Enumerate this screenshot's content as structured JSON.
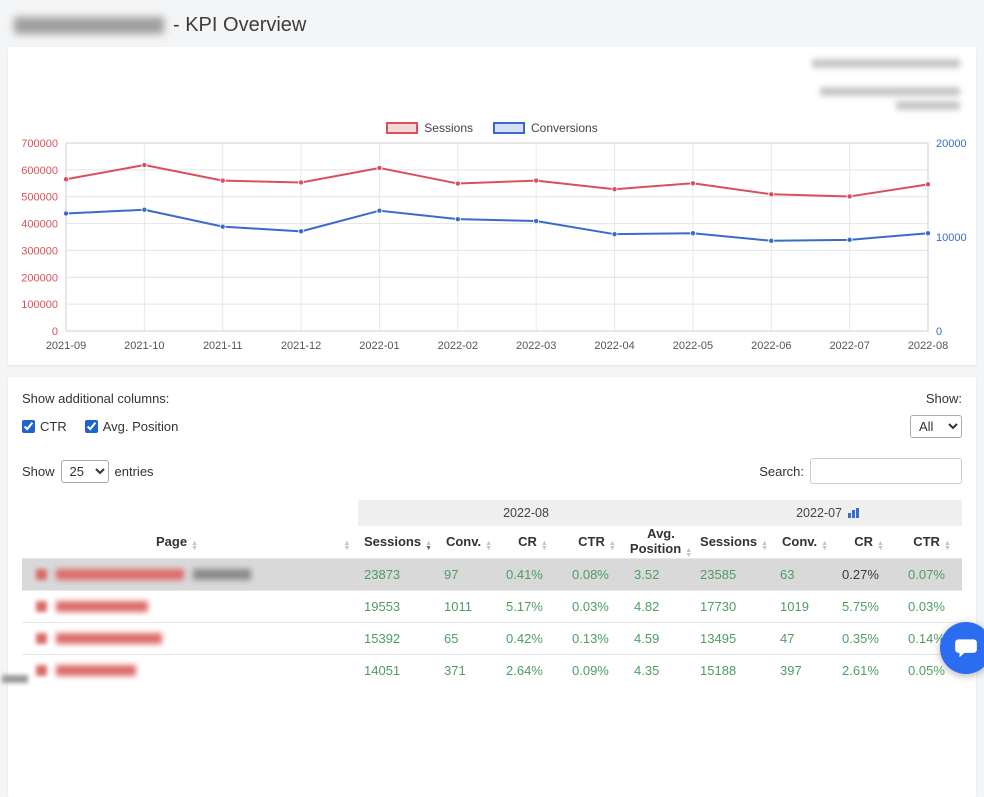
{
  "page": {
    "title_suffix": "- KPI Overview"
  },
  "chart_panel": {
    "info_lines_redacted": 3,
    "legend": [
      {
        "label": "Sessions",
        "color": "#d9505c",
        "fill": "#f3d8da"
      },
      {
        "label": "Conversions",
        "color": "#3a6bc9",
        "fill": "#d6e1f3"
      }
    ]
  },
  "chart_data": {
    "type": "line",
    "x": [
      "2021-09",
      "2021-10",
      "2021-11",
      "2021-12",
      "2022-01",
      "2022-02",
      "2022-03",
      "2022-04",
      "2022-05",
      "2022-06",
      "2022-07",
      "2022-08"
    ],
    "series": [
      {
        "name": "Sessions",
        "axis": "left",
        "color": "#d9505c",
        "values": [
          565000,
          618000,
          560000,
          553000,
          607000,
          549000,
          560000,
          528000,
          550000,
          509000,
          501000,
          546000
        ]
      },
      {
        "name": "Conversions",
        "axis": "right",
        "color": "#3a6bc9",
        "values": [
          12500,
          12900,
          11100,
          10600,
          12800,
          11900,
          11700,
          10300,
          10400,
          9600,
          9700,
          10400
        ]
      }
    ],
    "y_left": {
      "min": 0,
      "max": 700000,
      "step": 100000,
      "color": "#d9505c"
    },
    "y_right": {
      "min": 0,
      "max": 20000,
      "step": 10000,
      "color": "#3a6bc9"
    },
    "grid": true,
    "legend_position": "top",
    "title": ""
  },
  "table_panel": {
    "show_columns_label": "Show additional columns:",
    "column_toggles": [
      {
        "label": "CTR",
        "checked": true
      },
      {
        "label": "Avg. Position",
        "checked": true
      }
    ],
    "show_filter": {
      "label": "Show:",
      "value": "All"
    },
    "length_control": {
      "prefix": "Show",
      "value": "25",
      "suffix": "entries"
    },
    "search": {
      "label": "Search:",
      "value": ""
    },
    "column_groups": [
      {
        "label": "2022-08",
        "span": 5,
        "icon": ""
      },
      {
        "label": "2022-07",
        "span": 4,
        "icon": "bar-chart"
      }
    ],
    "columns": [
      {
        "label": "Page",
        "sortable": true
      },
      {
        "label": "",
        "sortable": true
      },
      {
        "label": "Sessions",
        "sortable": true,
        "sorted": "desc"
      },
      {
        "label": "Conv.",
        "sortable": true
      },
      {
        "label": "CR",
        "sortable": true
      },
      {
        "label": "CTR",
        "sortable": true
      },
      {
        "label": "Avg. Position",
        "sortable": true
      },
      {
        "label": "Sessions",
        "sortable": true
      },
      {
        "label": "Conv.",
        "sortable": true
      },
      {
        "label": "CR",
        "sortable": true
      },
      {
        "label": "CTR",
        "sortable": true
      }
    ],
    "rows": [
      {
        "page_redacted": true,
        "highlighted": true,
        "values": [
          "23873",
          "97",
          "0.41%",
          "0.08%",
          "3.52",
          "23585",
          "63",
          "0.27%",
          "0.07%"
        ],
        "dark_values": [
          7
        ]
      },
      {
        "page_redacted": true,
        "highlighted": false,
        "values": [
          "19553",
          "1011",
          "5.17%",
          "0.03%",
          "4.82",
          "17730",
          "1019",
          "5.75%",
          "0.03%"
        ],
        "dark_values": []
      },
      {
        "page_redacted": true,
        "highlighted": false,
        "values": [
          "15392",
          "65",
          "0.42%",
          "0.13%",
          "4.59",
          "13495",
          "47",
          "0.35%",
          "0.14%"
        ],
        "dark_values": []
      },
      {
        "page_redacted": true,
        "highlighted": false,
        "values": [
          "14051",
          "371",
          "2.64%",
          "0.09%",
          "4.35",
          "15188",
          "397",
          "2.61%",
          "0.05%"
        ],
        "dark_values": []
      }
    ]
  },
  "colors": {
    "positive_value": "#4f9d61",
    "dark_value": "#3c3c3c",
    "row_highlight": "#d9d9d9",
    "chat_widget": "#2b6df0"
  }
}
